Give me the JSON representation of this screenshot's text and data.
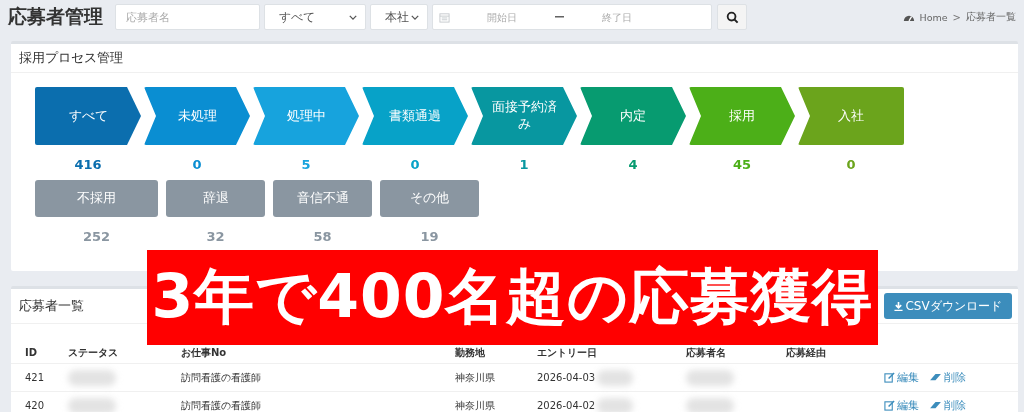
{
  "page_title": "応募者管理",
  "filters": {
    "name_placeholder": "応募者名",
    "status_select": "すべて",
    "office_select": "本社",
    "start_placeholder": "開始日",
    "range_separator": "ー",
    "end_placeholder": "終了日"
  },
  "breadcrumb": [
    "Home",
    ">",
    "応募者一覧"
  ],
  "process": {
    "title": "採用プロセス管理",
    "stages": [
      {
        "label": "すべて",
        "count": "416",
        "color": "#0b6eae"
      },
      {
        "label": "未処理",
        "count": "0",
        "color": "#0a8ed2"
      },
      {
        "label": "処理中",
        "count": "5",
        "color": "#17a3dd"
      },
      {
        "label": "書類通過",
        "count": "0",
        "color": "#07a2c8"
      },
      {
        "label": "面接予約済み",
        "count": "1",
        "color": "#0897a0"
      },
      {
        "label": "内定",
        "count": "4",
        "color": "#079b70"
      },
      {
        "label": "採用",
        "count": "45",
        "color": "#4caf18"
      },
      {
        "label": "入社",
        "count": "0",
        "color": "#6ba41c"
      }
    ],
    "others": [
      {
        "label": "不採用",
        "count": "252"
      },
      {
        "label": "辞退",
        "count": "32"
      },
      {
        "label": "音信不通",
        "count": "58"
      },
      {
        "label": "その他",
        "count": "19"
      }
    ]
  },
  "applicants": {
    "title": "応募者一覧",
    "csv_button": "CSVダウンロード",
    "columns": [
      "ID",
      "ステータス",
      "お仕事No",
      "勤務地",
      "エントリー日",
      "応募者名",
      "応募経由"
    ],
    "rows": [
      {
        "id": "421",
        "job": "訪問看護の看護師",
        "location": "神奈川県",
        "entry_date": "2026-04-03",
        "redacted": true,
        "edit": "編集",
        "delete": "削除"
      },
      {
        "id": "420",
        "job": "訪問看護の看護師",
        "location": "神奈川県",
        "entry_date": "2026-04-02",
        "redacted": true,
        "edit": "編集",
        "delete": "削除"
      }
    ]
  },
  "banner": "3年で400名超の応募獲得"
}
